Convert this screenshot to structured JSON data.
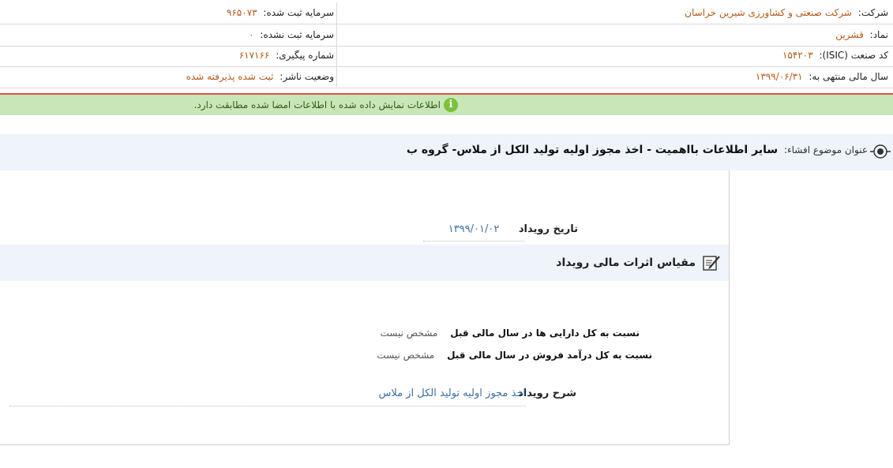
{
  "company_info": {
    "company_label": "شرکت:",
    "company_value": "شرکت صنعتی و کشاورزی شیرین خراسان",
    "symbol_label": "نماد:",
    "symbol_value": "قشرین",
    "isic_label": "کد صنعت (ISIC):",
    "isic_value": "۱۵۴۲۰۳",
    "fiscal_year_label": "سال مالی منتهی به:",
    "fiscal_year_value": "۱۳۹۹/۰۶/۳۱",
    "registered_capital_label": "سرمایه ثبت شده:",
    "registered_capital_value": "۹۶۵۰۷۳",
    "unregistered_capital_label": "سرمایه ثبت نشده:",
    "unregistered_capital_value": "۰",
    "tracking_number_label": "شماره پیگیری:",
    "tracking_number_value": "۶۱۷۱۶۶",
    "publisher_status_label": "وضعیت ناشر:",
    "publisher_status_value": "ثبت شده پذیرفته شده"
  },
  "message": {
    "text": "اطلاعات نمایش داده شده با اطلاعات امضا شده مطابقت دارد.",
    "icon": "info-icon",
    "icon_glyph": "i",
    "bar_color": "#c8e6b8",
    "icon_color": "#7ac23a"
  },
  "subject": {
    "label": "عنوان موضوع افشاء:",
    "value": "سایر اطلاعات بااهمیت - اخذ مجوز اولیه تولید الکل از ملاس- گروه ب"
  },
  "event": {
    "date_label": "تاریخ رویداد",
    "date_value": "۱۳۹۹/۰۱/۰۲",
    "financial_section_title": "مقیاس اثرات مالی رویداد",
    "assets_ratio_label": "نسبت به کل دارایی ها در سال مالی قبل",
    "assets_ratio_value": "مشخص نیست",
    "revenue_ratio_label": "نسبت به کل درآمد فروش در سال مالی قبل",
    "revenue_ratio_value": "مشخص نیست",
    "description_label": "شرح رویداد",
    "description_value": "اخذ مجوز اولیه تولید الکل از ملاس"
  },
  "colors": {
    "value_orange": "#b25a1a",
    "value_blue": "#3a6fa5",
    "section_bg": "#eef4fa",
    "alert_red_line": "#e05050"
  }
}
